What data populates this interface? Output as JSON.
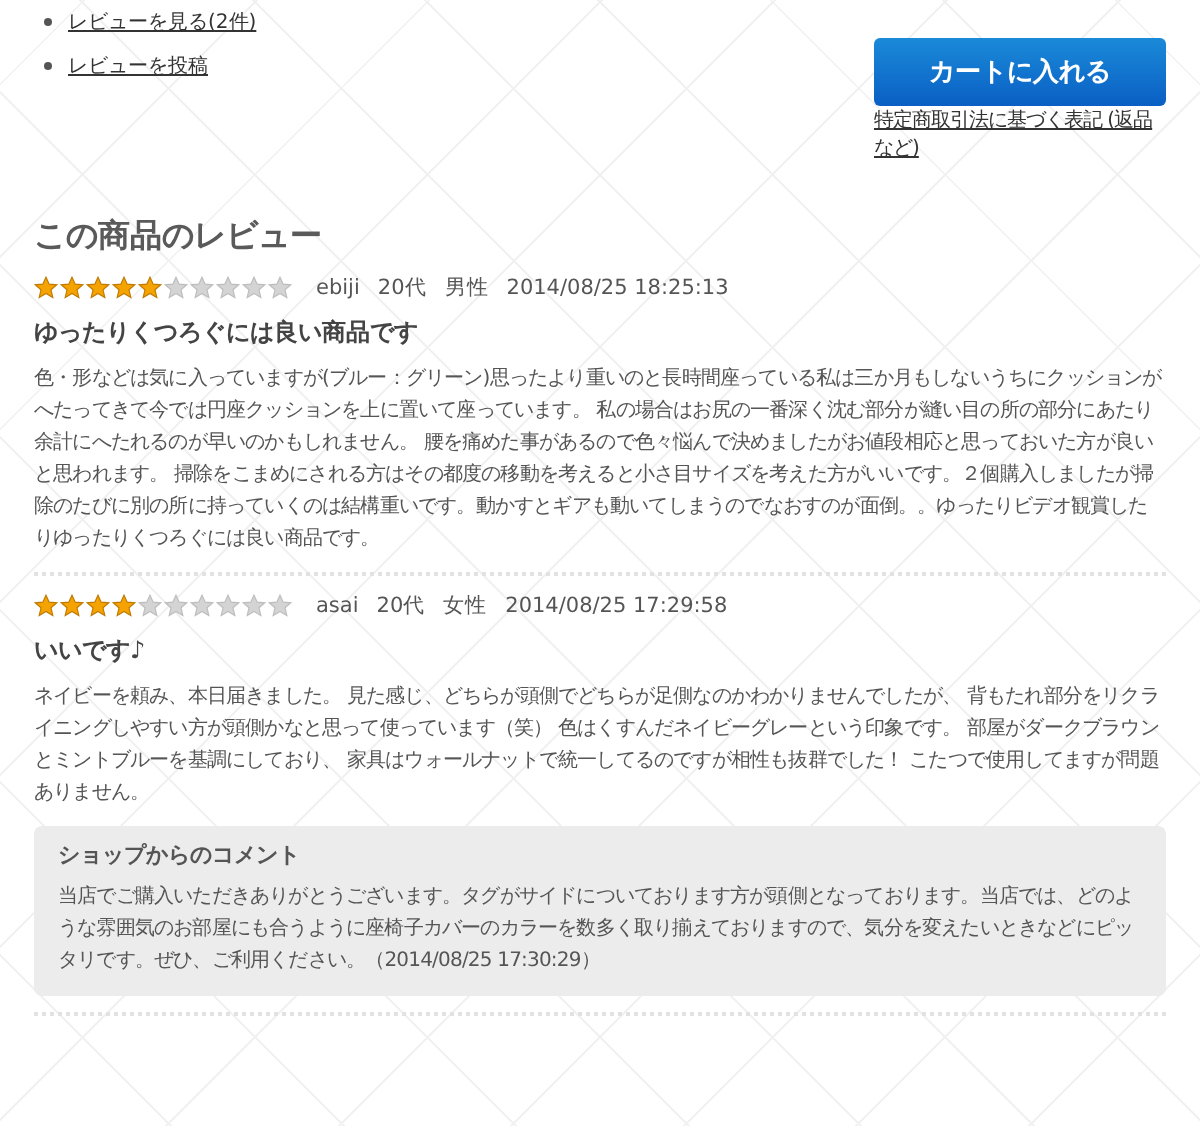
{
  "links": [
    {
      "label": "レビューを見る(2件)"
    },
    {
      "label": "レビューを投稿"
    }
  ],
  "cart_button": "カートに入れる",
  "legal_link": "特定商取引法に基づく表記 (返品など)",
  "section_title": "この商品のレビュー",
  "reviews": [
    {
      "stars": 5,
      "user": "ebiji",
      "age": "20代",
      "gender": "男性",
      "date": "2014/08/25 18:25:13",
      "title": "ゆったりくつろぐには良い商品です",
      "body": "色・形などは気に入っていますが(ブルー：グリーン)思ったより重いのと長時間座っている私は三か月もしないうちにクッションがへたってきて今では円座クッションを上に置いて座っています。 私の場合はお尻の一番深く沈む部分が縫い目の所の部分にあたり余計にへたれるのが早いのかもしれません。 腰を痛めた事があるので色々悩んで決めましたがお値段相応と思っておいた方が良いと思われます。 掃除をこまめにされる方はその都度の移動を考えると小さ目サイズを考えた方がいいです。２個購入しましたが掃除のたびに別の所に持っていくのは結構重いです。動かすとギアも動いてしまうのでなおすのが面倒。。ゆったりビデオ観賞したりゆったりくつろぐには良い商品です。"
    },
    {
      "stars": 4,
      "user": "asai",
      "age": "20代",
      "gender": "女性",
      "date": "2014/08/25 17:29:58",
      "title": "いいです♪",
      "body": "ネイビーを頼み、本日届きました。 見た感じ、どちらが頭側でどちらが足側なのかわかりませんでしたが、 背もたれ部分をリクライニングしやすい方が頭側かなと思って使っています（笑） 色はくすんだネイビーグレーという印象です。 部屋がダークブラウンとミントブルーを基調にしており、 家具はウォールナットで統一してるのですが相性も抜群でした！ こたつで使用してますが問題ありません。",
      "shop_comment": {
        "heading": "ショップからのコメント",
        "text": "当店でご購入いただきありがとうございます。タグがサイドについております方が頭側となっております。当店では、どのような雰囲気のお部屋にも合うように座椅子カバーのカラーを数多く取り揃えておりますので、気分を変えたいときなどにピッタリです。ぜひ、ご利用ください。（2014/08/25 17:30:29）"
      }
    }
  ]
}
